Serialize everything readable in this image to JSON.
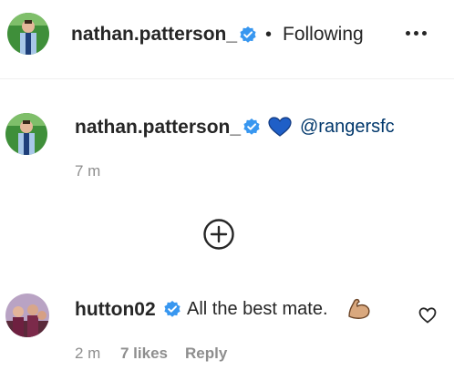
{
  "header": {
    "username": "nathan.patterson_",
    "separator": "•",
    "follow_status": "Following",
    "more_icon": "more-horizontal-icon"
  },
  "caption": {
    "username": "nathan.patterson_",
    "emoji": "blue-heart",
    "mention": "@rangersfc",
    "timestamp": "7 m"
  },
  "load_more_icon": "plus-circle-icon",
  "comment": {
    "username": "hutton02",
    "text": "All the best mate.",
    "emoji": "flexed-biceps",
    "timestamp": "2 m",
    "likes": "7 likes",
    "reply_label": "Reply",
    "like_icon": "heart-outline-icon"
  },
  "colors": {
    "verified": "#3897f0",
    "heart": "#1f5fc7",
    "mention": "#00376b",
    "secondary_text": "#8e8e8e",
    "primary_text": "#262626"
  }
}
